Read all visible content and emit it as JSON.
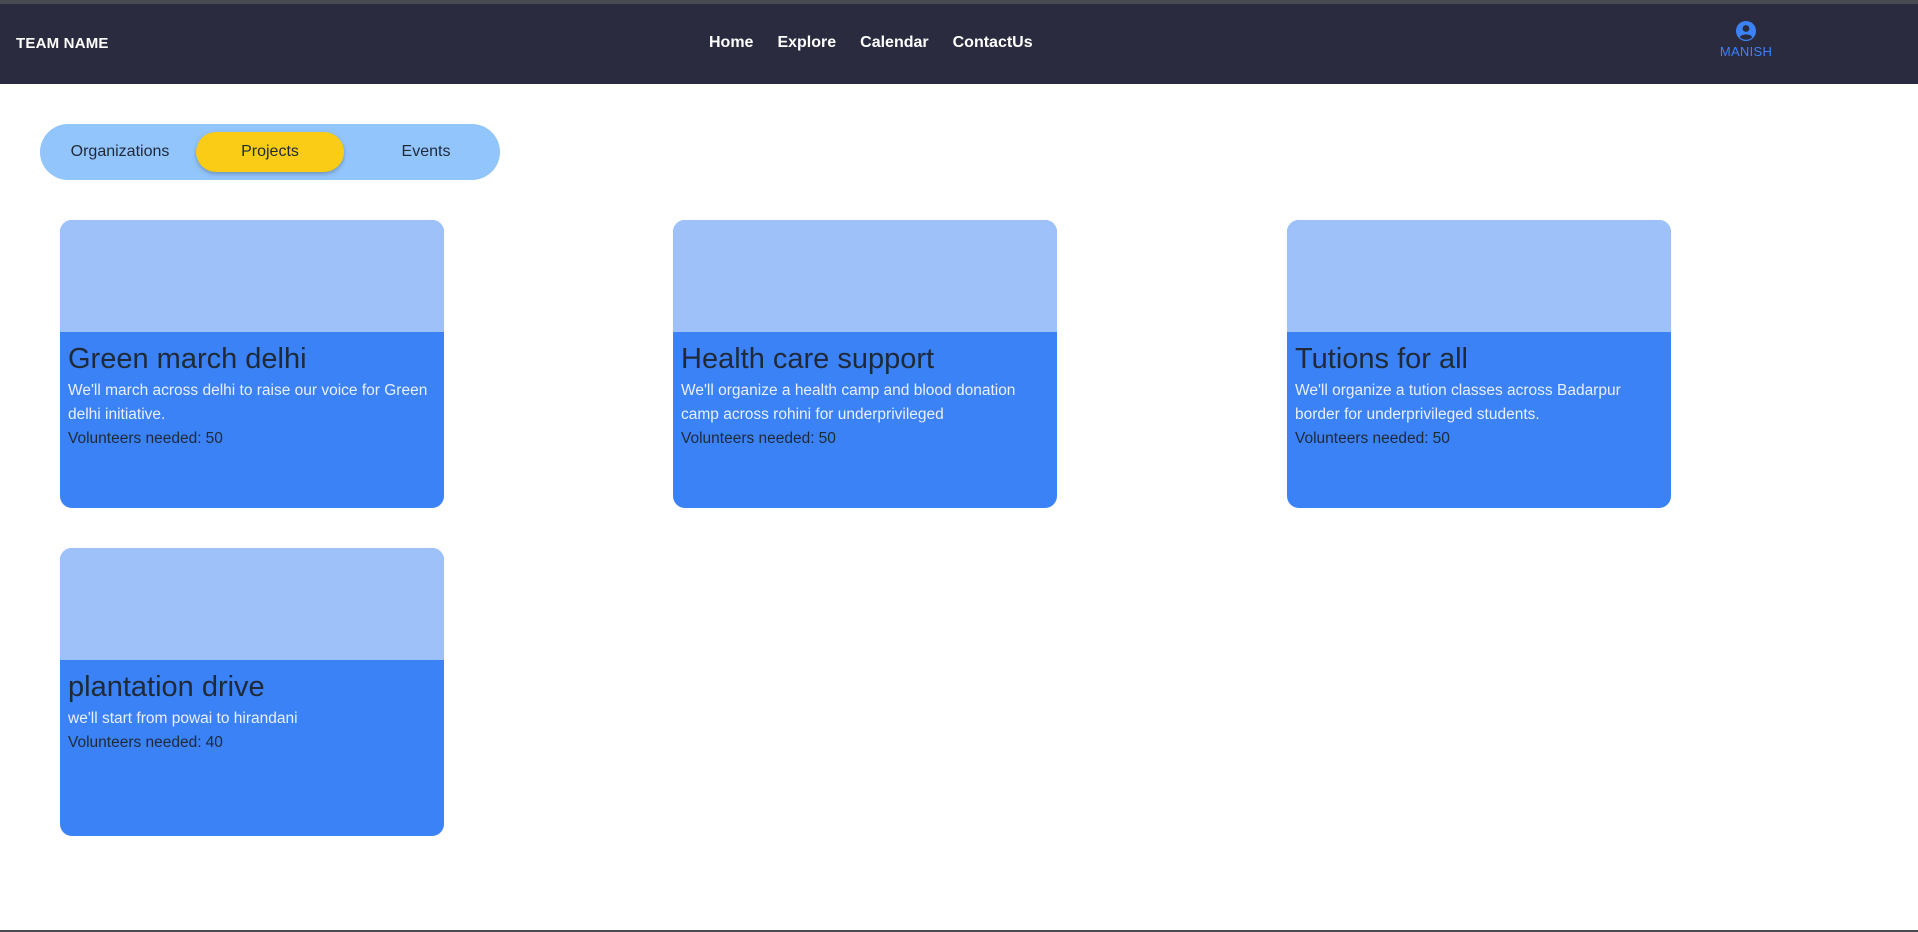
{
  "navbar": {
    "brand": "TEAM NAME",
    "links": [
      "Home",
      "Explore",
      "Calendar",
      "ContactUs"
    ],
    "user": {
      "icon": "user-circle-icon",
      "name": "MANISH"
    }
  },
  "tabs": {
    "items": [
      "Organizations",
      "Projects",
      "Events"
    ],
    "active": "Projects"
  },
  "cards": [
    {
      "title": "Green march delhi",
      "description": "We'll march across delhi to raise our voice for Green delhi initiative.",
      "volunteers_label": "Volunteers needed:",
      "volunteers": 50
    },
    {
      "title": "Health care support",
      "description": "We'll organize a health camp and blood donation camp across rohini for underprivileged",
      "volunteers_label": "Volunteers needed:",
      "volunteers": 50
    },
    {
      "title": "Tutions for all",
      "description": "We'll organize a tution classes across Badarpur border for underprivileged students.",
      "volunteers_label": "Volunteers needed:",
      "volunteers": 50
    },
    {
      "title": "plantation drive",
      "description": "we'll start from powai to hirandani",
      "volunteers_label": "Volunteers needed:",
      "volunteers": 40
    }
  ],
  "colors": {
    "navbar_bg": "#2b2b40",
    "tabs_bg": "#93c5fd",
    "active_tab": "#facc15",
    "card_bg": "#3b82f6",
    "card_image_bg": "#9ec1fa",
    "user_accent": "#3b82f6"
  }
}
